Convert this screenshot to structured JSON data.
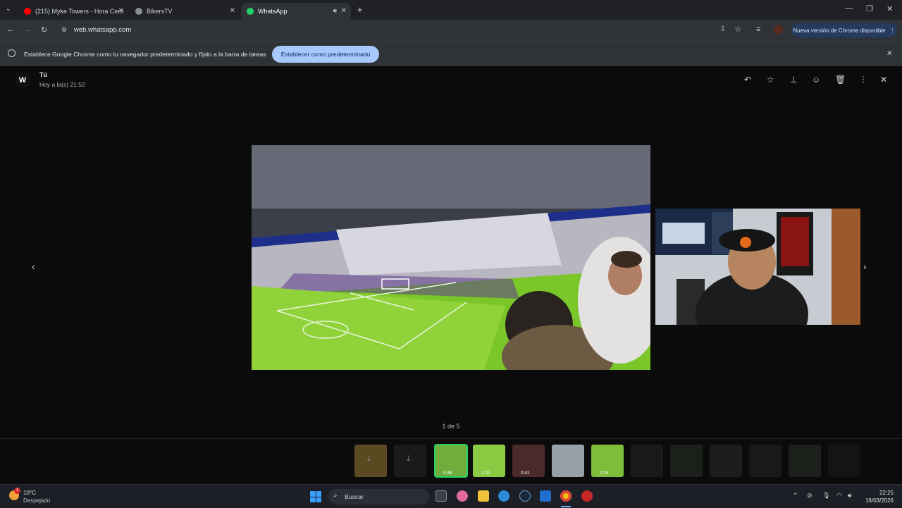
{
  "browser": {
    "tabs": [
      {
        "title": "(215) Myke Towers - Hora Cero",
        "icon": "youtube-icon"
      },
      {
        "title": "BikersTV",
        "icon": "globe-icon"
      },
      {
        "title": "WhatsApp",
        "icon": "whatsapp-icon",
        "active": true
      }
    ],
    "url": "web.whatsapp.com",
    "update_label": "Nueva versión de Chrome disponible"
  },
  "infobar": {
    "message": "Establece Google Chrome como tu navegador predeterminado y fíjalo a la barra de tareas",
    "button": "Establecer como predeterminado"
  },
  "viewer": {
    "sender": "Tú",
    "time": "Hoy a la(s) 21:52",
    "avatar_letter": "W",
    "counter": "1 de 5",
    "actions": [
      "reply-icon",
      "star-icon",
      "pin-icon",
      "emoji-icon",
      "trash-icon",
      "more-icon",
      "close-icon"
    ],
    "thumbs": [
      {
        "duration": "",
        "state": "download"
      },
      {
        "duration": "",
        "state": "download"
      },
      {
        "duration": "0:46",
        "state": "selected"
      },
      {
        "duration": "1:02",
        "state": "normal"
      },
      {
        "duration": "0:42",
        "state": "normal"
      },
      {
        "duration": "",
        "state": "normal"
      },
      {
        "duration": "2:28",
        "state": "normal"
      },
      {
        "duration": "",
        "state": "dim"
      },
      {
        "duration": "",
        "state": "dim"
      },
      {
        "duration": "",
        "state": "dim"
      },
      {
        "duration": "",
        "state": "dim"
      },
      {
        "duration": "",
        "state": "dim"
      },
      {
        "duration": "",
        "state": "dim"
      }
    ]
  },
  "taskbar": {
    "temperature": "10°C",
    "weather": "Despejado",
    "notification_count": "1",
    "search_placeholder": "Buscar",
    "time": "22:25",
    "date": "16/03/2026"
  },
  "colors": {
    "accent": "#25d366",
    "infobar_button": "#a8c7fa"
  }
}
